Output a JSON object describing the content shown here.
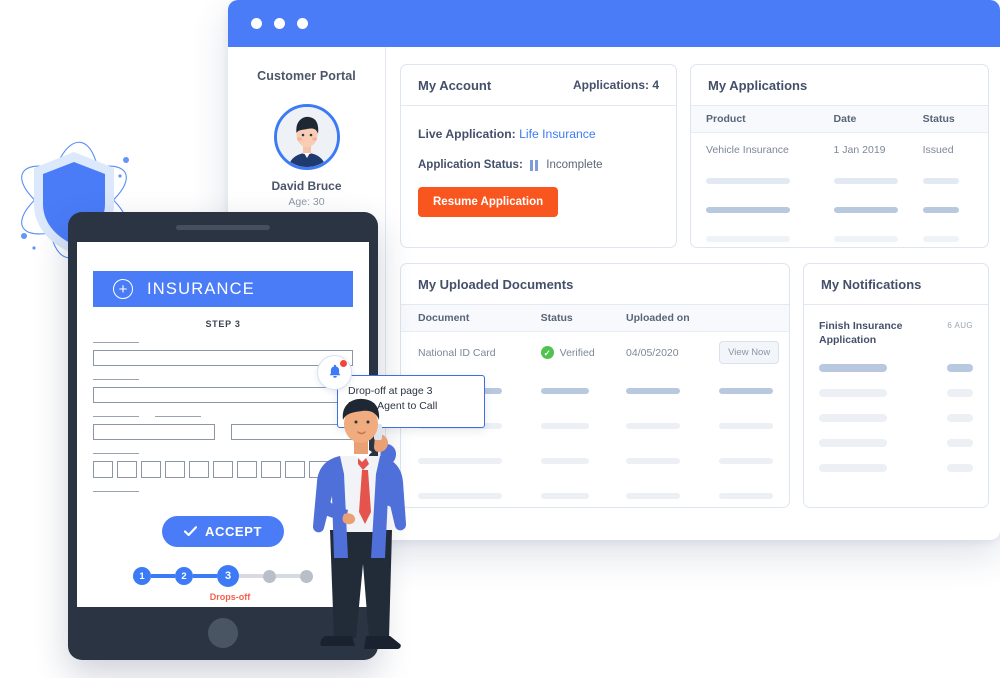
{
  "browser": {
    "traffic_dots": 3
  },
  "sidebar": {
    "title": "Customer Portal",
    "user_name": "David Bruce",
    "user_age": "Age: 30",
    "avatar_icon": "user-avatar-illustration"
  },
  "account_card": {
    "title": "My Account",
    "applications_count_label": "Applications: 4",
    "live_application_label": "Live Application:",
    "live_application_value": "Life Insurance",
    "status_label": "Application Status:",
    "status_value": "Incomplete",
    "status_icon": "pause-icon",
    "resume_button": "Resume Application",
    "accent_color": "#f9551f",
    "link_color": "#3d7bf6"
  },
  "applications_card": {
    "title": "My Applications",
    "columns": [
      "Product",
      "Date",
      "Status"
    ],
    "rows": [
      {
        "product": "Vehicle Insurance",
        "date": "1 Jan 2019",
        "status": "Issued"
      }
    ],
    "skeleton_rows": [
      {
        "opacity": "faint"
      },
      {
        "opacity": "solid"
      },
      {
        "opacity": "very-faint"
      }
    ]
  },
  "documents_card": {
    "title": "My Uploaded Documents",
    "columns": [
      "Document",
      "Status",
      "Uploaded on",
      ""
    ],
    "rows": [
      {
        "document": "National ID Card",
        "status": "Verified",
        "status_icon": "green-check-icon",
        "uploaded_on": "04/05/2020",
        "action": "View Now"
      }
    ],
    "skeleton_rows": 4,
    "verified_color": "#4fc24f"
  },
  "notifications_card": {
    "title": "My Notifications",
    "items": [
      {
        "text": "Finish Insurance Application",
        "date": "6 AUG"
      }
    ],
    "skeleton_rows": 5
  },
  "tablet": {
    "app_title": "INSURANCE",
    "app_icon": "plus-circle-icon",
    "step_label": "STEP 3",
    "accept_button": "ACCEPT",
    "accept_icon": "check-icon",
    "stepper": {
      "steps": [
        "1",
        "2",
        "3"
      ],
      "empty_steps": 2,
      "active_step": "3",
      "drop_label": "Drops-off",
      "drop_color": "#f4614d"
    },
    "brand_color": "#4a7cf8"
  },
  "callout": {
    "line1": "Drop-off at page 3",
    "line2": "Notify Agent to Call",
    "icon": "bell-icon",
    "border_color": "#3d6fe0"
  },
  "illustrations": {
    "shield": "shield-atom-icon",
    "person": "businessman-on-phone-illustration"
  }
}
